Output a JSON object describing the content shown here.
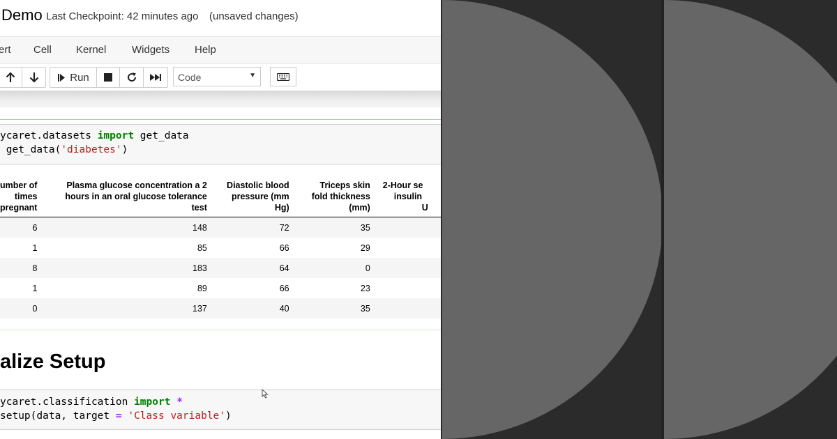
{
  "header": {
    "notebook_title": "Demo",
    "checkpoint": "Last Checkpoint: 42 minutes ago",
    "unsaved": "(unsaved changes)"
  },
  "menu": {
    "items": [
      "ert",
      "Cell",
      "Kernel",
      "Widgets",
      "Help"
    ]
  },
  "toolbar": {
    "run_label": "Run",
    "cell_type": "Code",
    "icons": [
      "arrow-up-icon",
      "arrow-down-icon",
      "run-icon",
      "stop-icon",
      "restart-icon",
      "fast-forward-icon",
      "keyboard-icon"
    ]
  },
  "cells": {
    "cell1": {
      "line1": {
        "pre": "ycaret.datasets ",
        "kw": "import",
        "post": " get_data"
      },
      "line2": {
        "pre": " get_data(",
        "str": "'diabetes'",
        "post": ")"
      }
    },
    "cell2": {
      "line1": {
        "pre": "ycaret.classification ",
        "kw": "import",
        "post": " ",
        "op": "*"
      },
      "line2": {
        "pre": "setup(data, target ",
        "op": "=",
        "mid": " ",
        "str": "'Class variable'",
        "post": ")"
      }
    }
  },
  "table": {
    "columns": [
      [
        "umber of",
        "times",
        "pregnant"
      ],
      [
        "Plasma glucose concentration a 2",
        "hours in an oral glucose tolerance",
        "test"
      ],
      [
        "Diastolic blood",
        "pressure (mm",
        "Hg)"
      ],
      [
        "Triceps skin",
        "fold thickness",
        "(mm)"
      ],
      [
        "2-Hour se",
        "insulin",
        "U"
      ]
    ],
    "rows": [
      [
        "6",
        "148",
        "72",
        "35",
        ""
      ],
      [
        "1",
        "85",
        "66",
        "29",
        ""
      ],
      [
        "8",
        "183",
        "64",
        "0",
        ""
      ],
      [
        "1",
        "89",
        "66",
        "23",
        ""
      ],
      [
        "0",
        "137",
        "40",
        "35",
        ""
      ]
    ]
  },
  "section_heading": "alize Setup",
  "colors": {
    "background_dark": "#2b2b2b",
    "circle_gray": "#666666",
    "keyword_green": "#008000",
    "string_red": "#ba2121",
    "operator_purple": "#aa22ff"
  }
}
